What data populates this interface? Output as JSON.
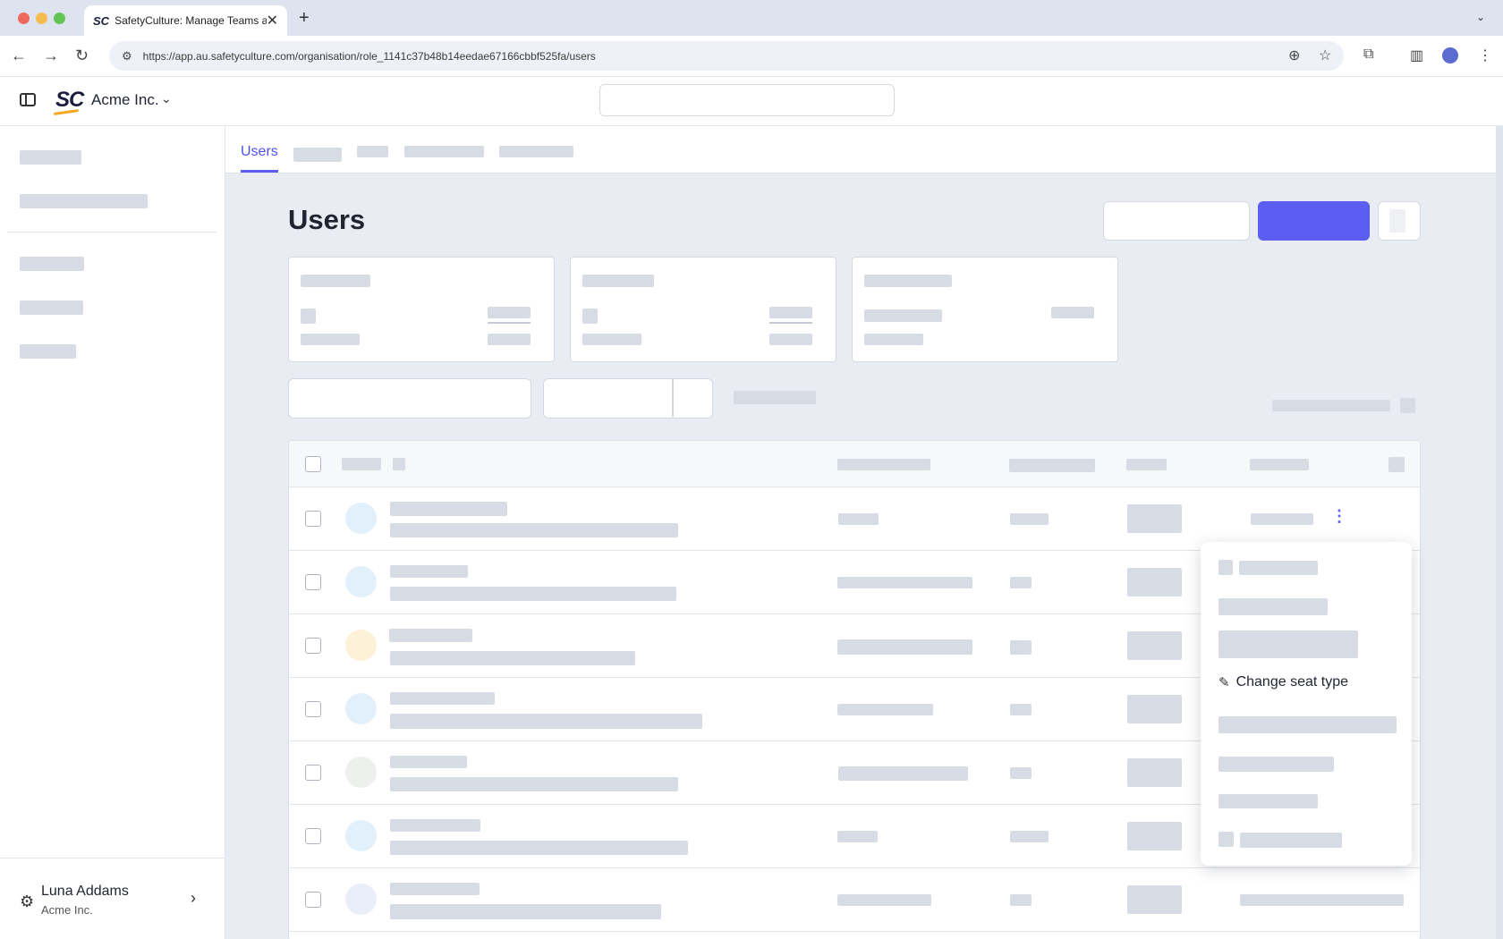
{
  "browser": {
    "tab_title": "SafetyCulture: Manage Teams and...",
    "tab_favicon": "SC",
    "tab_close": "✕",
    "new_tab": "+",
    "url": "https://app.au.safetyculture.com/organisation/role_1141c37b48b14eedae67166cbbf525fa/users"
  },
  "header": {
    "logo": "SC",
    "org_name": "Acme Inc.",
    "org_chevron": "⌄"
  },
  "sidebar": {
    "user_name": "Luna Addams",
    "user_org": "Acme Inc.",
    "chevron": "›"
  },
  "tabs": {
    "active": "Users"
  },
  "page": {
    "title": "Users"
  },
  "dropdown": {
    "change_seat_type": "Change seat type"
  },
  "icons": {
    "back": "←",
    "forward": "→",
    "reload": "↻",
    "zoom": "⊕",
    "star": "☆",
    "extensions": "⧉",
    "menu": "⋮",
    "gear": "⚙",
    "kebab": "⋮",
    "seat": "✎"
  },
  "colors": {
    "accent": "#5b5ef0",
    "skeleton": "#d7dbe4",
    "background": "#e9ecf3"
  }
}
